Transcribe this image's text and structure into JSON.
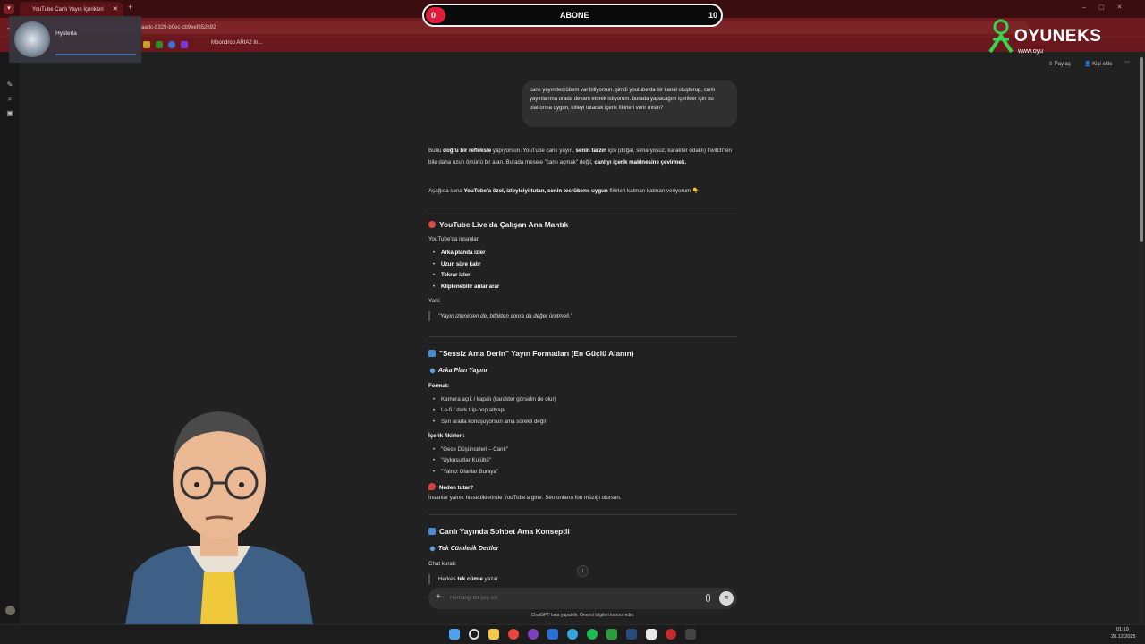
{
  "browser": {
    "tab_title": "YouTube Canlı Yayın İçerikleri",
    "url_fragment": "aadc-8329-b0ec-cb9eef852b92",
    "bookmark_label": "Moondrop ARIA2 In..."
  },
  "top_actions": {
    "share": "Paylaş",
    "add_person": "Kişi ekle"
  },
  "user_message": "canlı yayın tecrübem var biliyorsun. şimdi youtube'da bir kanal oluşturup, canlı yayınlarıma orada devam etmek istiyorum. burada yapacağım içerikler için bu platforma uygun, kitleyi tutacak içerik fikirleri verir misin?",
  "intro": {
    "p1_a": "Bunu ",
    "p1_b": "doğru bir refleksle",
    "p1_c": " yapıyorsun. YouTube canlı yayın, ",
    "p1_d": "senin tarzın",
    "p1_e": " için (doğal, senaryosuz, karakter odaklı) Twitch'ten bile daha uzun ömürlü bir alan. Burada mesele \"canlı açmak\" değil, ",
    "p1_f": "canlıyı içerik makinesine çevirmek.",
    "p2_a": "Aşağıda sana ",
    "p2_b": "YouTube'a özel, izleyiciyi tutan, senin tecrübene uygun",
    "p2_c": " fikirleri katman katman veriyorum 👇"
  },
  "section1": {
    "title": "YouTube Live'da Çalışan Ana Mantık",
    "lead": "YouTube'da insanlar:",
    "items": [
      "Arka planda izler",
      "Uzun süre kalır",
      "Tekrar izler",
      "Kliplenebilir anlar arar"
    ],
    "yani": "Yani:",
    "quote": "\"Yayın izlenirken de, bittikten sonra da değer üretmeli.\""
  },
  "section2": {
    "title": "\"Sessiz Ama Derin\" Yayın Formatları (En Güçlü Alanın)",
    "sub": "Arka Plan Yayını",
    "format_label": "Format:",
    "format_items": [
      "Kamera açık / kapalı (karakter görselin de olur)",
      "Lo-fi / dark trip-hop altyapı",
      "Sen arada konuşuyorsun ama sürekli değil"
    ],
    "ideas_label": "İçerik fikirleri:",
    "ideas": [
      "\"Gece Düşünceleri – Canlı\"",
      "\"Uykusuzlar Kulübü\"",
      "\"Yalnız Olanlar Buraya\""
    ],
    "why_label": "Neden tutar?",
    "why_text": "İnsanlar yalnız hissettiklerinde YouTube'a girer. Sen onların fon müziği olursun."
  },
  "section3": {
    "title": "Canlı Yayında Sohbet Ama Konseptli",
    "sub": "Tek Cümlelik Dertler",
    "chat_rule": "Chat kuralı:",
    "quote_a": "Herkes ",
    "quote_b": "tek cümle",
    "quote_c": " yazar."
  },
  "composer": {
    "placeholder": "Herhangi bir şey sor"
  },
  "disclaimer": "ChatGPT hata yapabilir. Önemli bilgileri kontrol edin.",
  "overlay": {
    "sub_label": "ABONE",
    "sub_current": "0",
    "sub_goal": "10",
    "sub_progress": 0.0,
    "logo_text": "OYUNEKS",
    "logo_url": "www.oyu",
    "music_title": "Hysteria"
  },
  "taskbar": {
    "time": "01:19",
    "date": "28.12.2025"
  },
  "colors": {
    "accent_red": "#e11d3c",
    "chrome_red": "#6e1a1f",
    "bg": "#212121"
  }
}
